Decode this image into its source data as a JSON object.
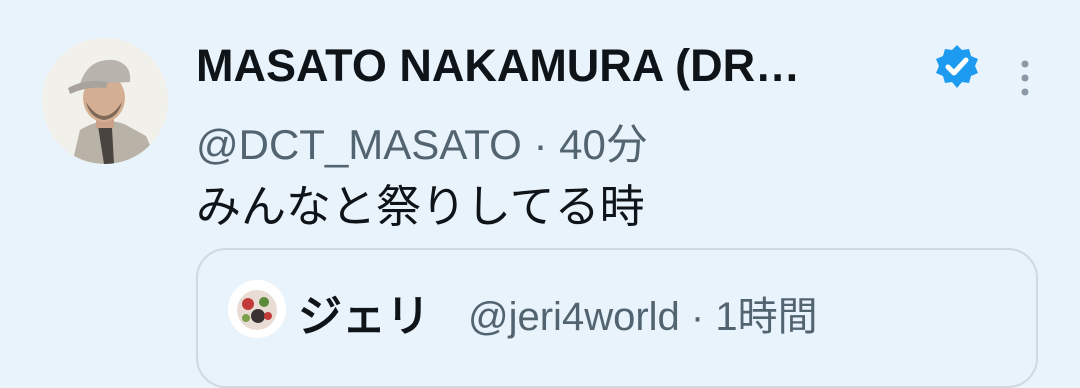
{
  "tweet": {
    "display_name": "MASATO NAKAMURA (DR…",
    "verified_icon": "verified-badge-icon",
    "more_icon": "more-options-icon",
    "handle": "@DCT_MASATO",
    "separator": "·",
    "time": "40分",
    "text": "みんなと祭りしてる時"
  },
  "quote": {
    "display_name": "ジェリ",
    "handle": "@jeri4world",
    "separator": "·",
    "time": "1時間"
  },
  "colors": {
    "background": "#e9f3fb",
    "primary_text": "#0f1419",
    "secondary_text": "#536471",
    "verified_blue": "#1d9bf0",
    "border": "#cfd9de"
  }
}
